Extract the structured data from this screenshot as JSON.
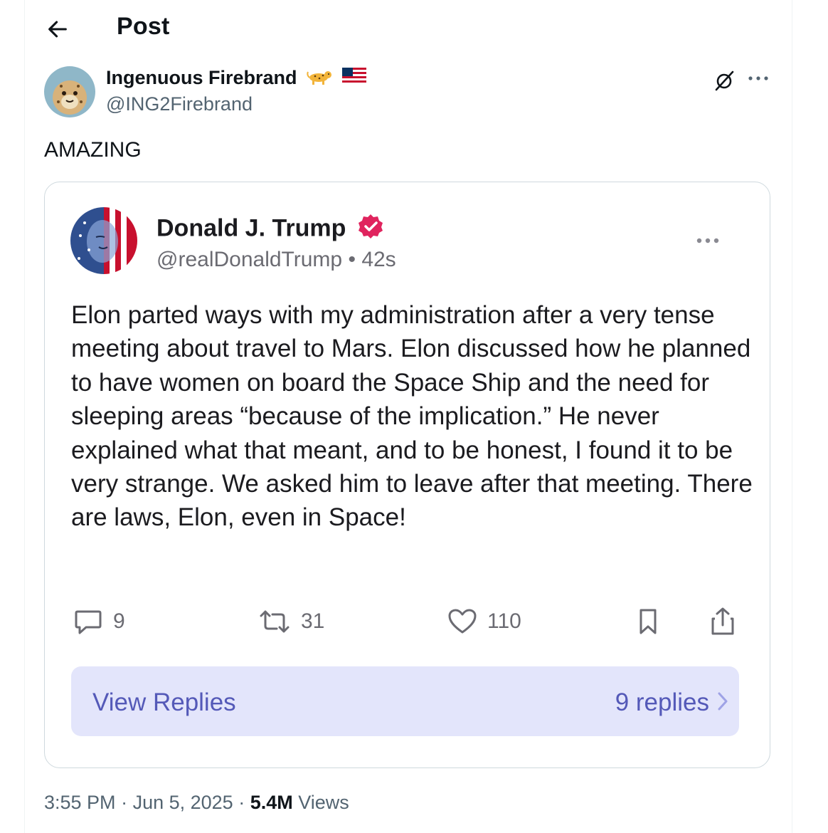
{
  "header": {
    "title": "Post",
    "back_icon": "arrow-left-icon"
  },
  "author": {
    "name": "Ingenuous Firebrand",
    "handle": "@ING2Firebrand",
    "emojis": [
      "leopard-emoji",
      "us-flag-emoji"
    ]
  },
  "post": {
    "text": "AMAZING"
  },
  "embedded": {
    "name": "Donald J. Trump",
    "handle": "@realDonaldTrump",
    "separator": "•",
    "time": "42s",
    "body": "Elon parted ways with my administration after a very tense meeting about travel to Mars. Elon discussed how he planned to have women on board the Space Ship and the need for sleeping areas “because of the implication.” He never explained what that meant, and to be honest, I found it to be very strange. We asked him to leave after that meeting. There are laws, Elon, even in Space!",
    "actions": {
      "replies": "9",
      "reposts": "31",
      "likes": "110"
    },
    "view_replies_label": "View Replies",
    "replies_count_label": "9 replies",
    "badge_color": "#e0245e",
    "accent_color": "#5459b8"
  },
  "meta": {
    "time": "3:55 PM",
    "dot1": " · ",
    "date": "Jun 5, 2025",
    "dot2": " · ",
    "views": "5.4M",
    "views_label": " Views"
  }
}
